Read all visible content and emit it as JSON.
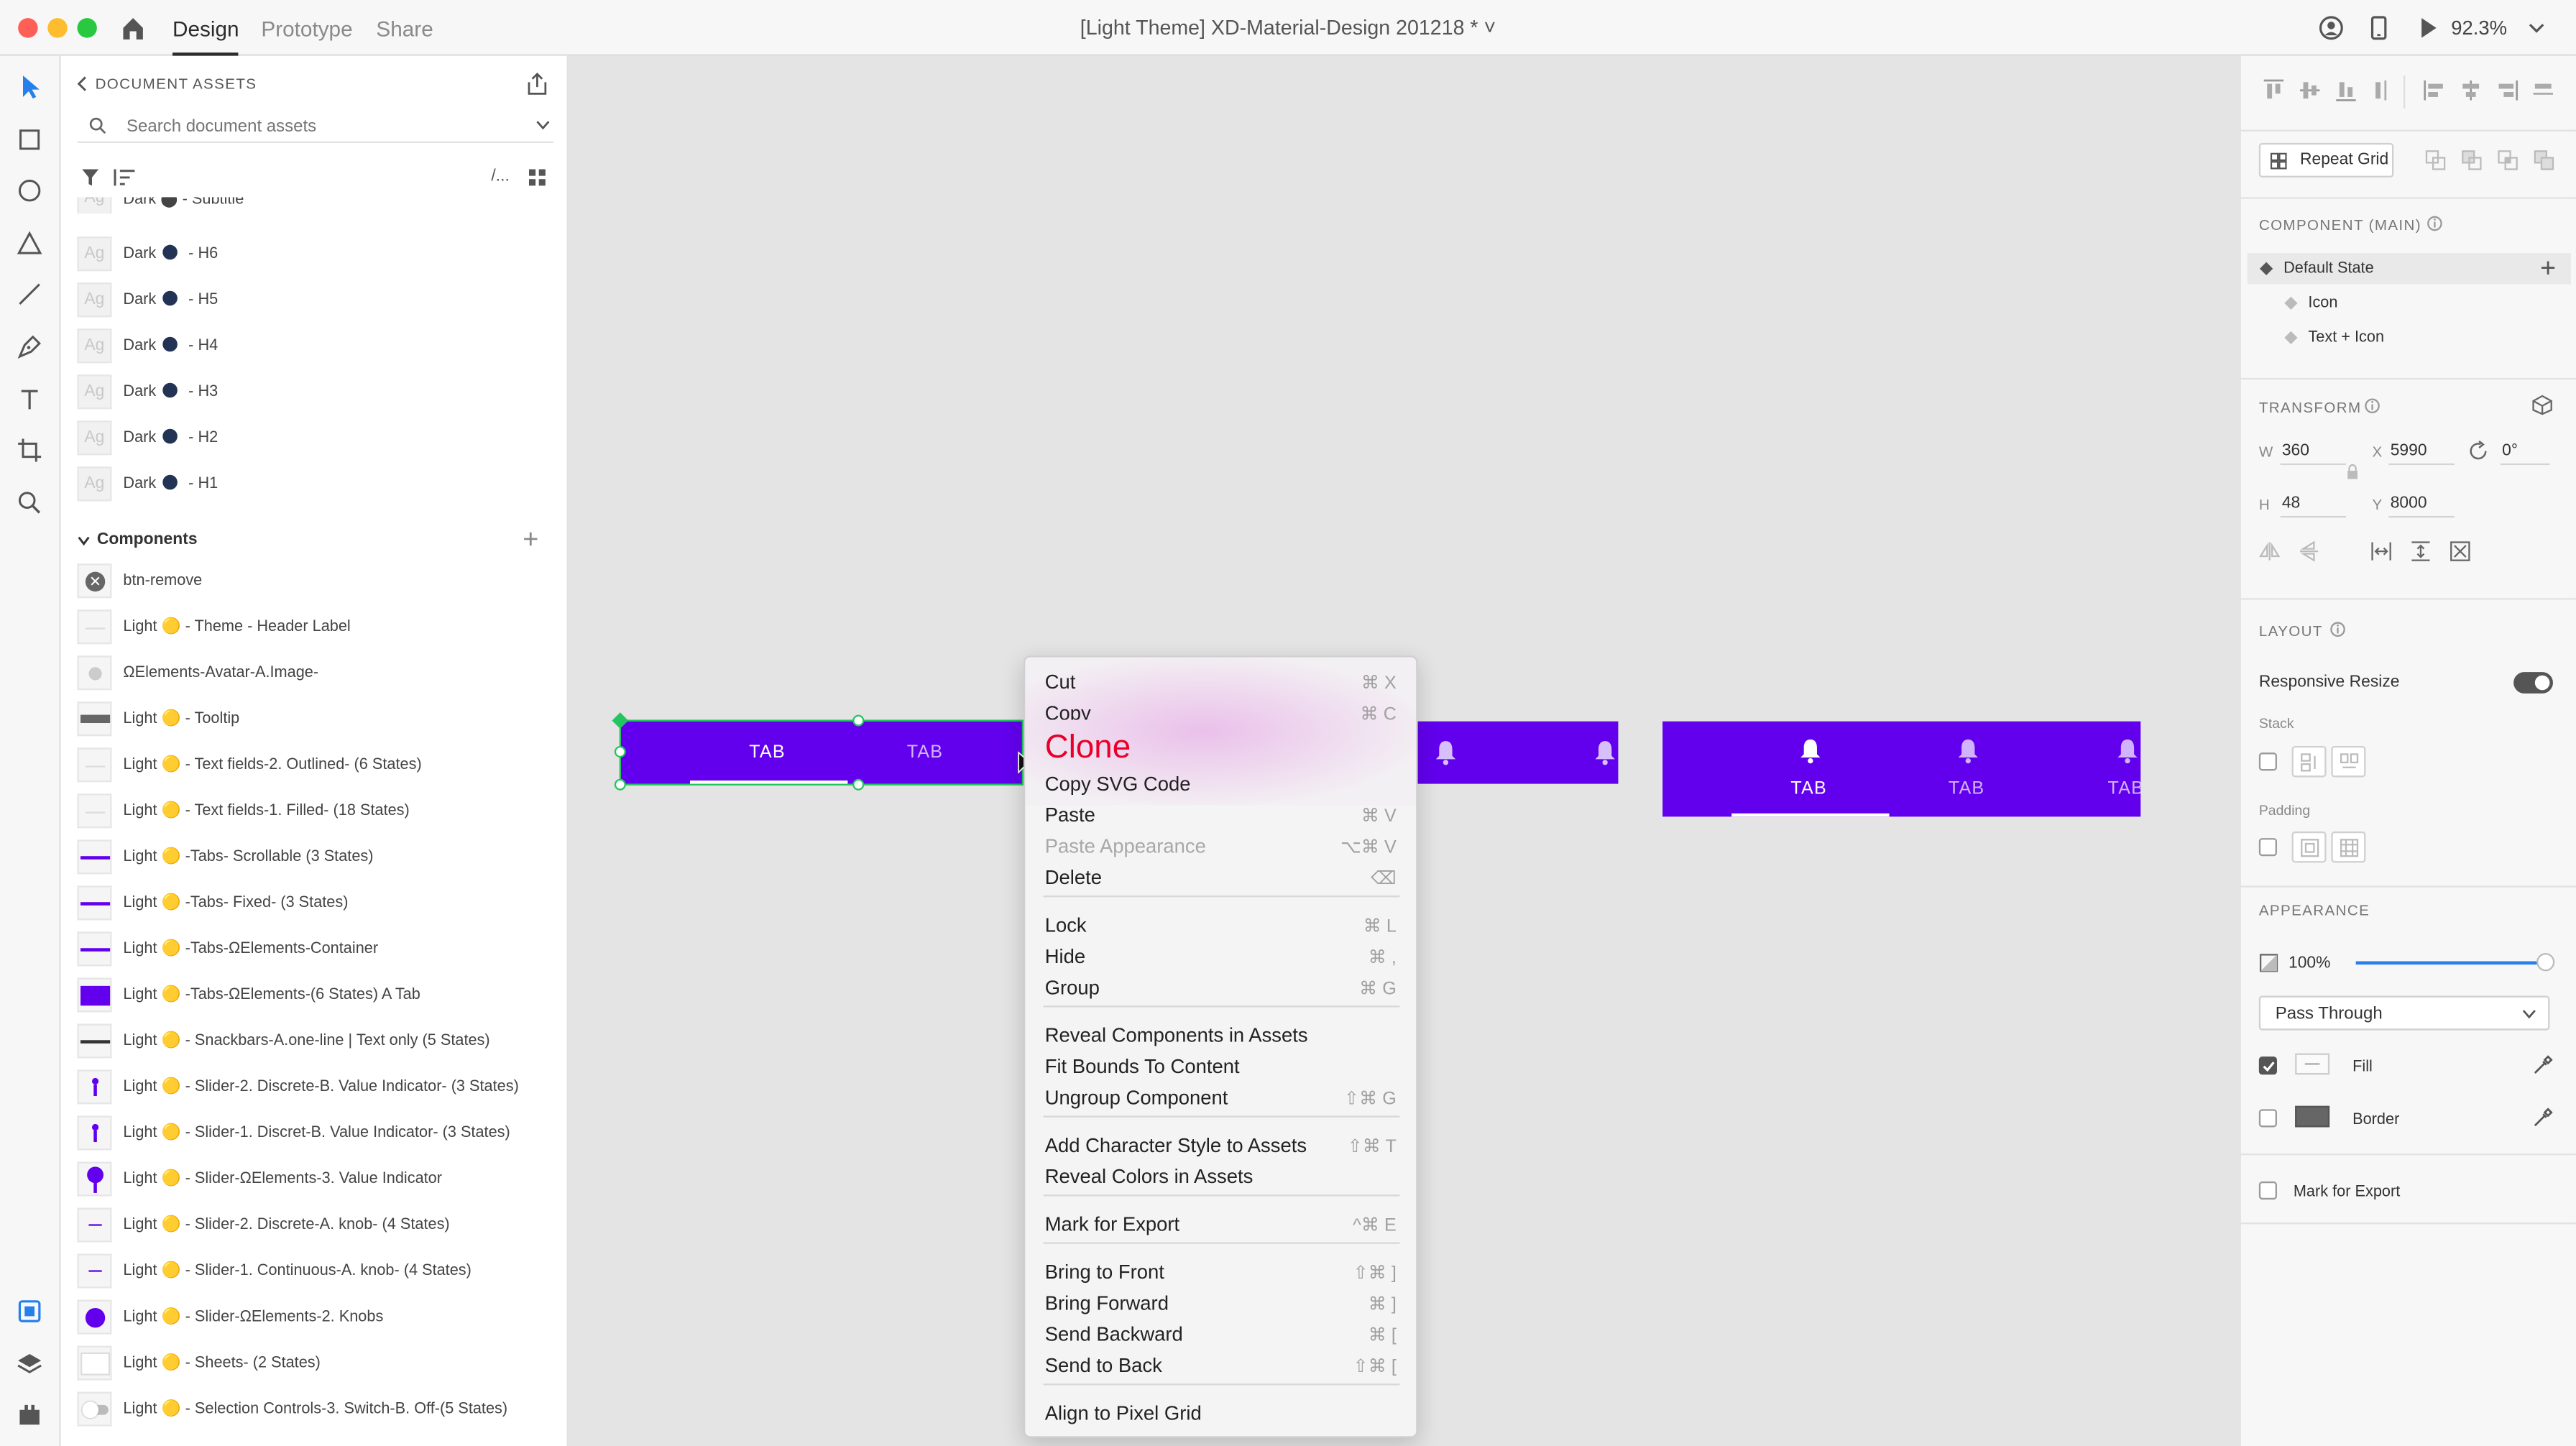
{
  "app": {
    "mode_tabs": [
      "Design",
      "Prototype",
      "Share"
    ],
    "document_title": "[Light Theme] XD-Material-Design 201218 * ˅",
    "zoom": "92.3%"
  },
  "assets": {
    "header": "DOCUMENT ASSETS",
    "search_placeholder": "Search document assets",
    "filter_text": "/...",
    "thumb_text": "Ag",
    "styles": [
      {
        "label": "Dark ⬤ - Subtitle"
      },
      {
        "label": "Dark",
        "suffix": " - H6"
      },
      {
        "label": "Dark",
        "suffix": " - H5"
      },
      {
        "label": "Dark",
        "suffix": " - H4"
      },
      {
        "label": "Dark",
        "suffix": " - H3"
      },
      {
        "label": "Dark",
        "suffix": " - H2"
      },
      {
        "label": "Dark",
        "suffix": " - H1"
      }
    ],
    "components_header": "Components",
    "components": [
      "btn-remove",
      "Light 🟡 - Theme - Header Label",
      "ΩElements-Avatar-A.Image-",
      "Light 🟡 - Tooltip",
      "Light 🟡 - Text fields-2. Outlined- (6 States)",
      "Light 🟡 - Text fields-1. Filled- (18 States)",
      "Light 🟡 -Tabs- Scrollable (3 States)",
      "Light 🟡 -Tabs- Fixed- (3 States)",
      "Light 🟡 -Tabs-ΩElements-Container",
      "Light 🟡 -Tabs-ΩElements-(6 States) A Tab",
      "Light 🟡 - Snackbars-A.one-line | Text only (5 States)",
      "Light 🟡 - Slider-2. Discrete-B. Value Indicator- (3 States)",
      "Light 🟡 - Slider-1. Discret-B. Value Indicator- (3 States)",
      "Light 🟡 - Slider-ΩElements-3. Value Indicator",
      "Light 🟡 - Slider-2. Discrete-A. knob- (4 States)",
      "Light 🟡 - Slider-1. Continuous-A. knob- (4 States)",
      "Light 🟡 - Slider-ΩElements-2. Knobs",
      "Light 🟡 - Sheets- (2 States)",
      "Light 🟡 - Selection Controls-3. Switch-B. Off-(5 States)"
    ]
  },
  "canvas": {
    "tab_label": "TAB",
    "tab_color": "#6200ee"
  },
  "context_menu": {
    "overlay_caption": "Clone",
    "items": [
      {
        "label": "Cut",
        "shortcut": "⌘ X"
      },
      {
        "label": "Copy",
        "shortcut": "⌘ C"
      },
      {
        "label": "Copy SVG Code",
        "shortcut": ""
      },
      {
        "label": "Paste",
        "shortcut": "⌘ V"
      },
      {
        "label": "Paste Appearance",
        "shortcut": "⌥⌘ V"
      },
      {
        "label": "Delete",
        "shortcut": "⌫"
      },
      {
        "label": "Lock",
        "shortcut": "⌘ L"
      },
      {
        "label": "Hide",
        "shortcut": "⌘ ,"
      },
      {
        "label": "Group",
        "shortcut": "⌘ G"
      },
      {
        "label": "Reveal Components in Assets",
        "shortcut": ""
      },
      {
        "label": "Fit Bounds To Content",
        "shortcut": ""
      },
      {
        "label": "Ungroup Component",
        "shortcut": "⇧⌘ G"
      },
      {
        "label": "Add Character Style to Assets",
        "shortcut": "⇧⌘ T"
      },
      {
        "label": "Reveal Colors in Assets",
        "shortcut": ""
      },
      {
        "label": "Mark for Export",
        "shortcut": "^⌘ E"
      },
      {
        "label": "Bring to Front",
        "shortcut": "⇧⌘ ]"
      },
      {
        "label": "Bring Forward",
        "shortcut": "⌘ ]"
      },
      {
        "label": "Send Backward",
        "shortcut": "⌘ ["
      },
      {
        "label": "Send to Back",
        "shortcut": "⇧⌘ ["
      },
      {
        "label": "Align to Pixel Grid",
        "shortcut": ""
      }
    ]
  },
  "properties": {
    "repeat_grid": "Repeat Grid",
    "component_header": "COMPONENT (MAIN)",
    "states": [
      "Default State",
      "Icon",
      "Text + Icon"
    ],
    "transform_header": "TRANSFORM",
    "w_label": "W",
    "w_value": "360",
    "h_label": "H",
    "h_value": "48",
    "x_label": "X",
    "x_value": "5990",
    "y_label": "Y",
    "y_value": "8000",
    "rotation": "0°",
    "layout_header": "LAYOUT",
    "responsive_resize": "Responsive Resize",
    "stack_label": "Stack",
    "padding_label": "Padding",
    "appearance_header": "APPEARANCE",
    "opacity": "100%",
    "opacity_level": 1.0,
    "blend_mode": "Pass Through",
    "fill_label": "Fill",
    "border_label": "Border",
    "mark_for_export": "Mark for Export"
  }
}
